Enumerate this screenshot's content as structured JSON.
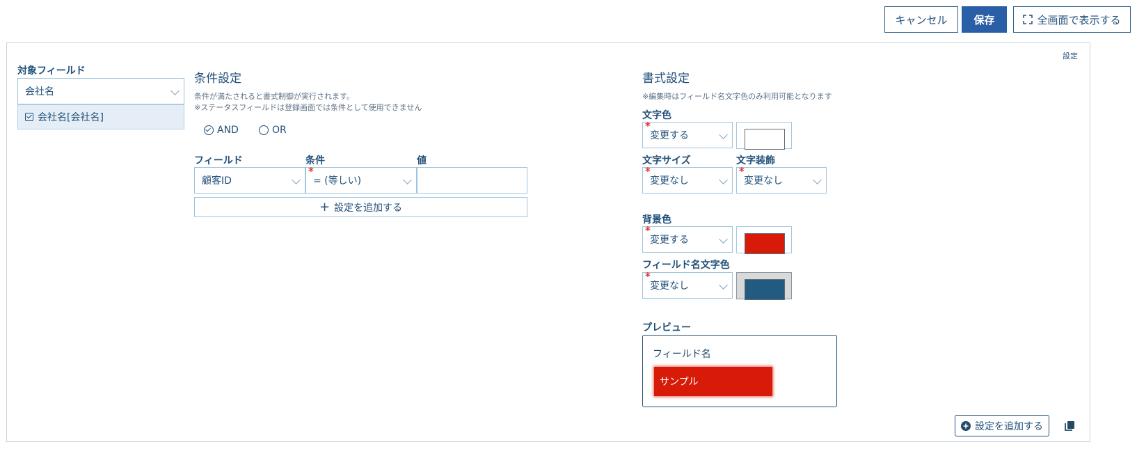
{
  "toolbar": {
    "cancel_label": "キャンセル",
    "save_label": "保存",
    "fullscreen_label": "全画面で表示する"
  },
  "panel": {
    "settings_link": "設定"
  },
  "target_field": {
    "label": "対象フィールド",
    "select_value": "会社名",
    "selected_item": "会社名[会社名]"
  },
  "conditions": {
    "title": "条件設定",
    "note_lines": [
      "条件が満たされると書式制御が実行されます。",
      "※ステータスフィールドは登録画面では条件として使用できません"
    ],
    "logic": [
      {
        "label": "AND",
        "checked": true
      },
      {
        "label": "OR",
        "checked": false
      }
    ],
    "headers": {
      "field": "フィールド",
      "condition": "条件",
      "value": "値"
    },
    "row": {
      "field": "顧客ID",
      "condition": "= (等しい)",
      "value": ""
    },
    "add_label": "設定を追加する"
  },
  "format": {
    "title": "書式設定",
    "note": "※編集時はフィールド名文字色のみ利用可能となります",
    "text_color": {
      "label": "文字色",
      "select": "変更する",
      "color": "#ffffff"
    },
    "text_size": {
      "label": "文字サイズ",
      "select": "変更なし"
    },
    "text_decoration": {
      "label": "文字装飾",
      "select": "変更なし"
    },
    "bg_color": {
      "label": "背景色",
      "select": "変更する",
      "color": "#d81b08"
    },
    "field_name_color": {
      "label": "フィールド名文字色",
      "select": "変更なし",
      "color": "#235a80"
    },
    "preview": {
      "label": "プレビュー",
      "field_name": "フィールド名",
      "sample": "サンプル"
    }
  },
  "footer": {
    "add_label": "設定を追加する"
  }
}
